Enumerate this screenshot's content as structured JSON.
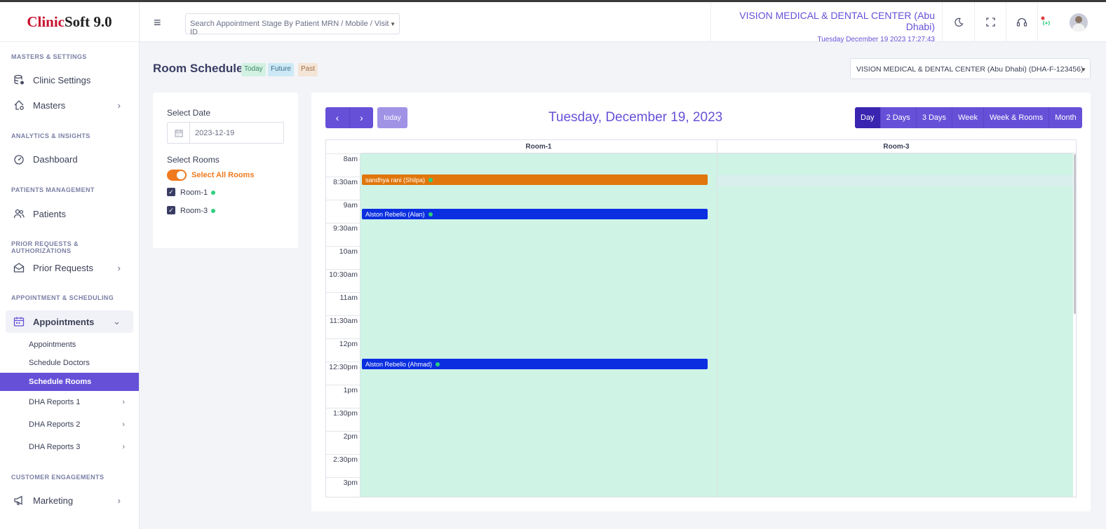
{
  "brand": {
    "part1": "Clinic",
    "part2": "Soft",
    "version": "9.0"
  },
  "sidebar": {
    "sections": [
      {
        "title": "MASTERS & SETTINGS"
      },
      {
        "title": "ANALYTICS & INSIGHTS"
      },
      {
        "title": "PATIENTS MANAGEMENT"
      },
      {
        "title": "PRIOR REQUESTS & AUTHORIZATIONS"
      },
      {
        "title": "APPOINTMENT & SCHEDULING"
      },
      {
        "title": "CUSTOMER ENGAGEMENTS"
      }
    ],
    "items": [
      {
        "label": "Clinic Settings",
        "icon": "database-gear-icon"
      },
      {
        "label": "Masters",
        "icon": "home-gear-icon"
      },
      {
        "label": "Dashboard",
        "icon": "gauge-icon"
      },
      {
        "label": "Patients",
        "icon": "users-icon"
      },
      {
        "label": "Prior Requests",
        "icon": "envelope-open-icon"
      },
      {
        "label": "Appointments",
        "icon": "calendar-icon"
      },
      {
        "label": "Marketing",
        "icon": "megaphone-icon"
      }
    ],
    "subitems": [
      {
        "label": "Appointments"
      },
      {
        "label": "Schedule Doctors"
      },
      {
        "label": "Schedule Rooms"
      },
      {
        "label": "DHA Reports 1"
      },
      {
        "label": "DHA Reports 2"
      },
      {
        "label": "DHA Reports 3"
      }
    ]
  },
  "topbar": {
    "search_placeholder": "Search Appointment Stage By Patient MRN / Mobile / Visit ID",
    "center_name": "VISION MEDICAL & DENTAL CENTER (Abu Dhabi)",
    "datetime": "Tuesday December 19 2023 17:27:43"
  },
  "page": {
    "title": "Room Scheduler",
    "badges": {
      "today": "Today",
      "future": "Future",
      "past": "Past"
    },
    "clinic_select": "VISION MEDICAL & DENTAL CENTER (Abu Dhabi) (DHA-F-123456)"
  },
  "filters": {
    "date_label": "Select Date",
    "date_value": "2023-12-19",
    "rooms_label": "Select Rooms",
    "select_all": "Select All Rooms",
    "rooms": [
      {
        "label": "Room-1"
      },
      {
        "label": "Room-3"
      }
    ]
  },
  "calendar": {
    "today_label": "today",
    "title": "Tuesday, December 19, 2023",
    "views": [
      "Day",
      "2 Days",
      "3 Days",
      "Week",
      "Week & Rooms",
      "Month"
    ],
    "columns": [
      "Room-1",
      "Room-3"
    ],
    "times": [
      "8am",
      "8:30am",
      "9am",
      "9:30am",
      "10am",
      "10:30am",
      "11am",
      "11:30am",
      "12pm",
      "12:30pm",
      "1pm",
      "1:30pm",
      "2pm",
      "2:30pm",
      "3pm"
    ],
    "events": [
      {
        "label": "sandhya rani (Shilpa)",
        "color": "#e0760c"
      },
      {
        "label": "Alston Rebello (Alan)",
        "color": "#0a2ee0"
      },
      {
        "label": "Alston Rebello (Ahmad)",
        "color": "#0a2ee0"
      }
    ]
  },
  "colors": {
    "accent": "#6650d8",
    "room_bg": "#cff3e5",
    "toggle": "#f07a1e"
  }
}
